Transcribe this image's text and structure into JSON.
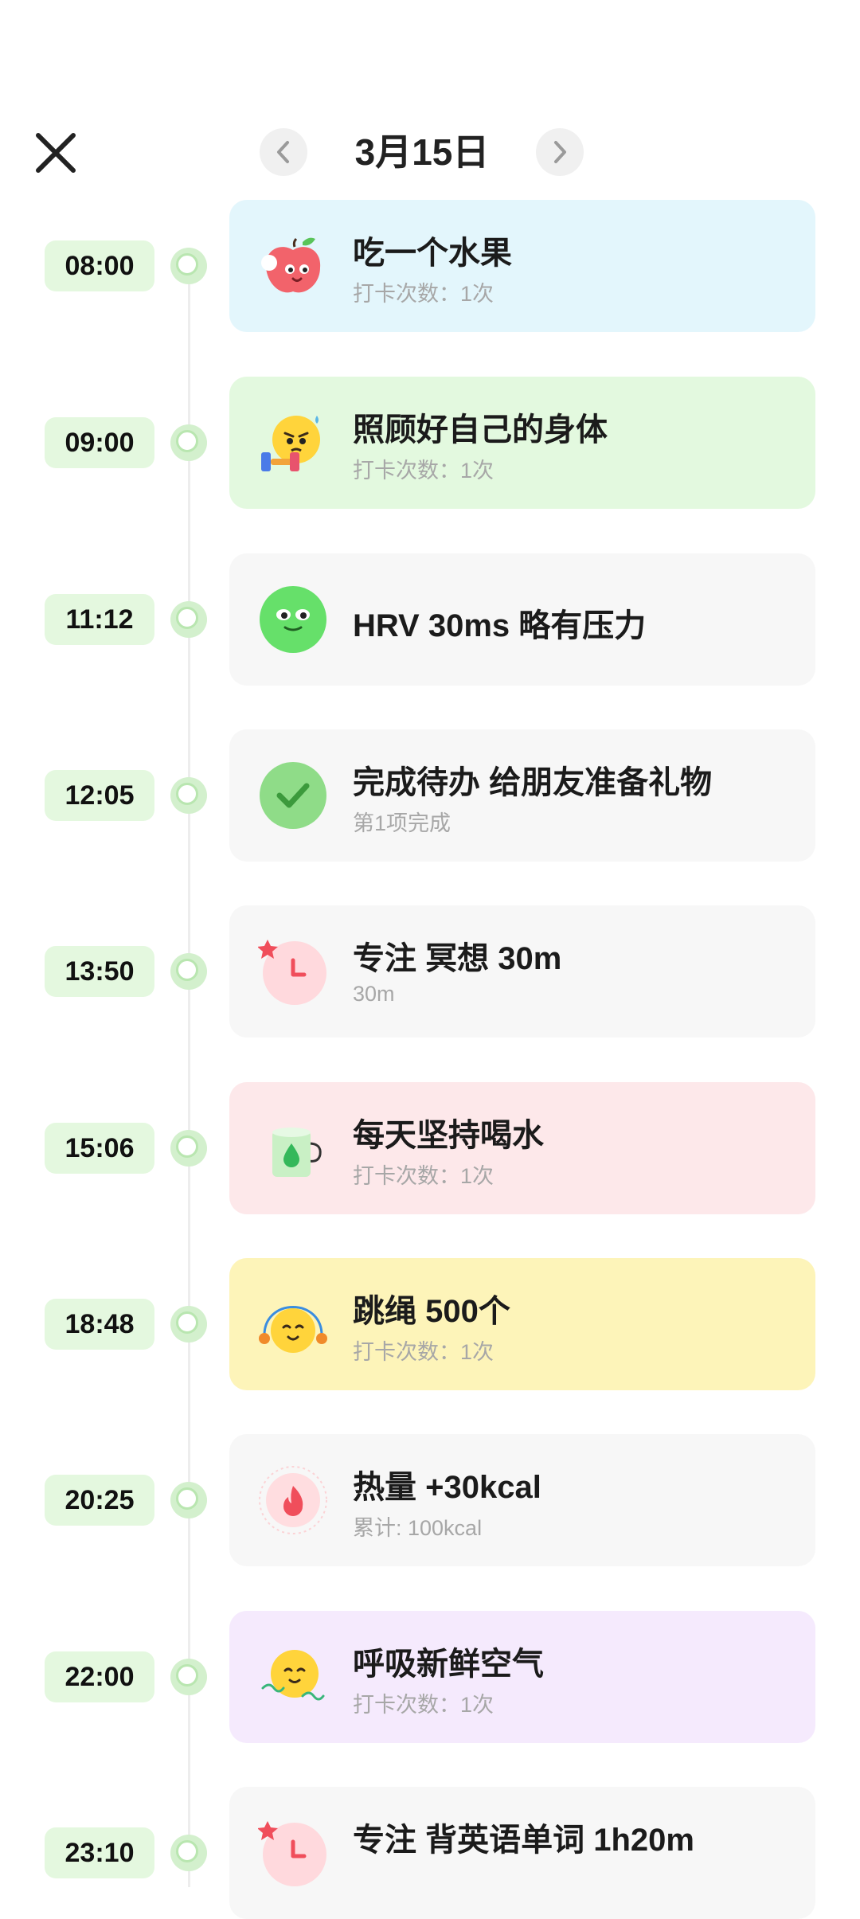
{
  "header": {
    "date": "3月15日"
  },
  "colors": {
    "pill_bg": "#e4f8df",
    "dot": "#b9e6b0",
    "blue": "#e3f6fc",
    "green": "#e3f9df",
    "gray": "#f7f7f7",
    "pink": "#fde8ea",
    "yellow": "#fdf4b9",
    "purple": "#f5eafd"
  },
  "entries": [
    {
      "time": "08:00",
      "title": "吃一个水果",
      "sub": "打卡次数：1次",
      "icon": "apple-icon"
    },
    {
      "time": "09:00",
      "title": "照顾好自己的身体",
      "sub": "打卡次数：1次",
      "icon": "dumbbell-face-icon"
    },
    {
      "time": "11:12",
      "title": "HRV 30ms 略有压力",
      "sub": "",
      "icon": "green-face-icon"
    },
    {
      "time": "12:05",
      "title": "完成待办 给朋友准备礼物",
      "sub": "第1项完成",
      "icon": "check-icon"
    },
    {
      "time": "13:50",
      "title": "专注 冥想 30m",
      "sub": "30m",
      "icon": "clock-icon"
    },
    {
      "time": "15:06",
      "title": "每天坚持喝水",
      "sub": "打卡次数：1次",
      "icon": "water-cup-icon"
    },
    {
      "time": "18:48",
      "title": "跳绳 500个",
      "sub": "打卡次数：1次",
      "icon": "jump-rope-icon"
    },
    {
      "time": "20:25",
      "title": "热量 +30kcal",
      "sub": "累计: 100kcal",
      "icon": "flame-icon"
    },
    {
      "time": "22:00",
      "title": "呼吸新鲜空气",
      "sub": "打卡次数：1次",
      "icon": "fresh-air-icon"
    },
    {
      "time": "23:10",
      "title": "专注 背英语单词 1h20m",
      "sub": "",
      "icon": "clock-icon"
    }
  ]
}
